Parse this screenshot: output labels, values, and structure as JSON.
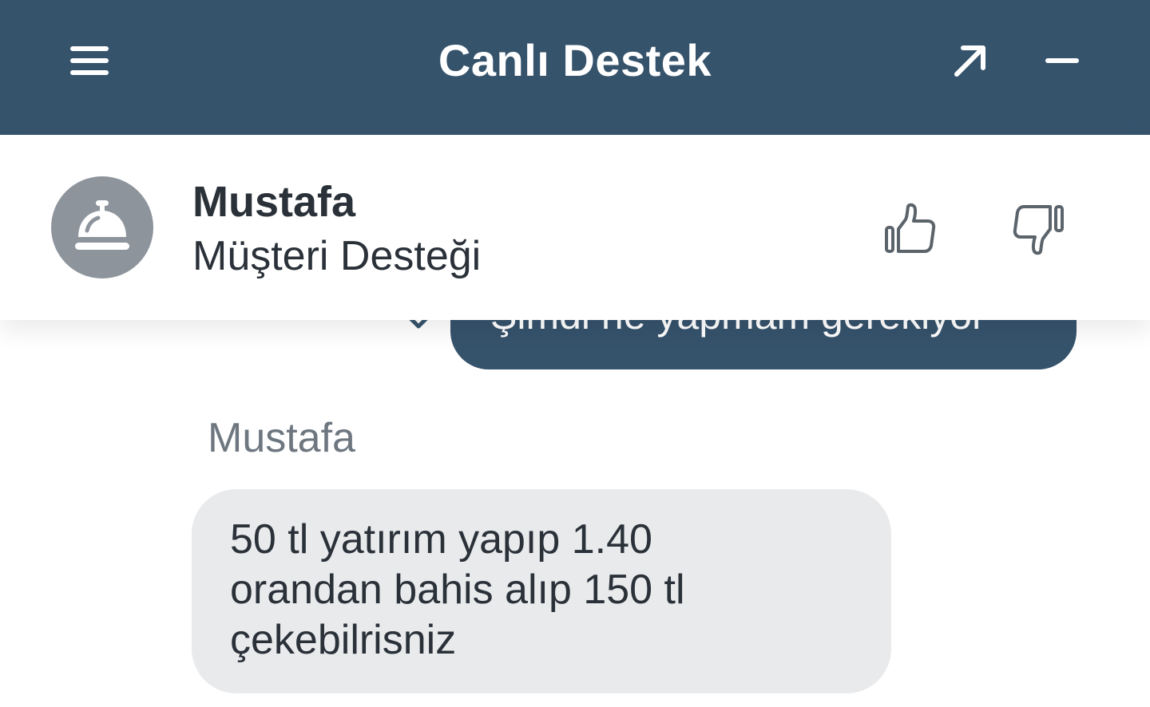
{
  "topbar": {
    "title": "Canlı Destek",
    "background": "#36536c",
    "icons": {
      "menu": "hamburger-menu-icon",
      "expand": "arrow-up-right-icon",
      "minimize": "minus-icon"
    }
  },
  "agent": {
    "name": "Mustafa",
    "role": "Müşteri Desteği",
    "avatar_icon": "service-bell-icon",
    "avatar_color": "#8d949c",
    "rating_icons": {
      "up": "thumbs-up-icon",
      "down": "thumbs-down-icon"
    }
  },
  "messages": [
    {
      "from": "user",
      "text": "Şimdi ne yapmam gerekiyor",
      "status_icon": "chevron-down-icon"
    },
    {
      "from": "agent",
      "sender_label": "Mustafa",
      "text": "50 tl yatırım yapıp 1.40\norandan bahis alıp 150 tl\nçekebilrisniz"
    }
  ]
}
